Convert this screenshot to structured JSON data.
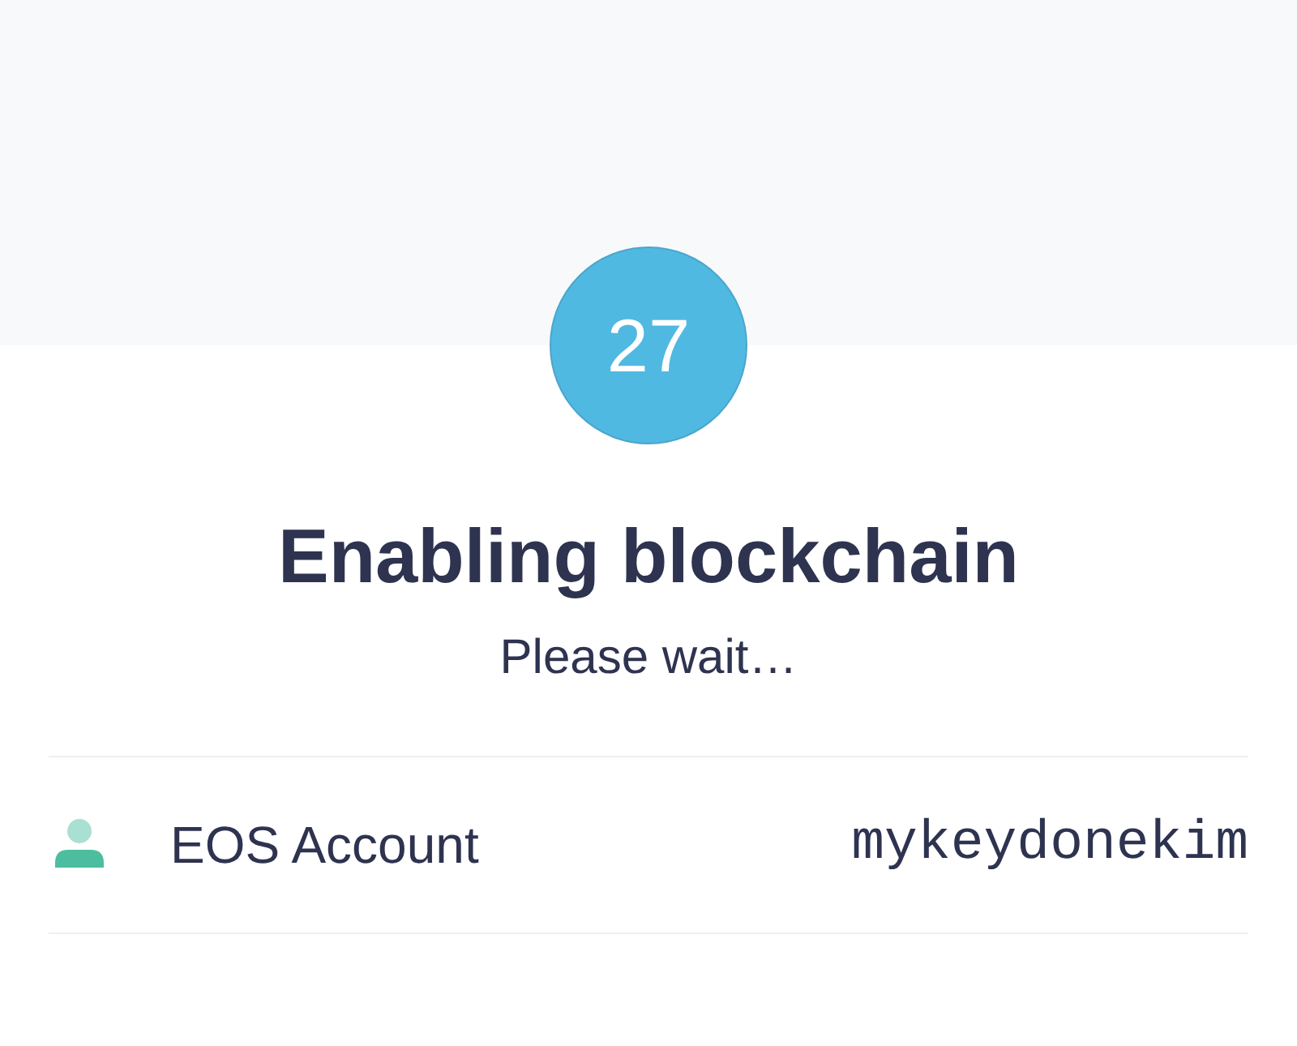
{
  "header": {
    "countdown": "27"
  },
  "title": "Enabling blockchain",
  "subtitle": "Please wait…",
  "rows": [
    {
      "kind": "account",
      "label": "EOS Account",
      "value": "mykeydonekim"
    }
  ]
}
